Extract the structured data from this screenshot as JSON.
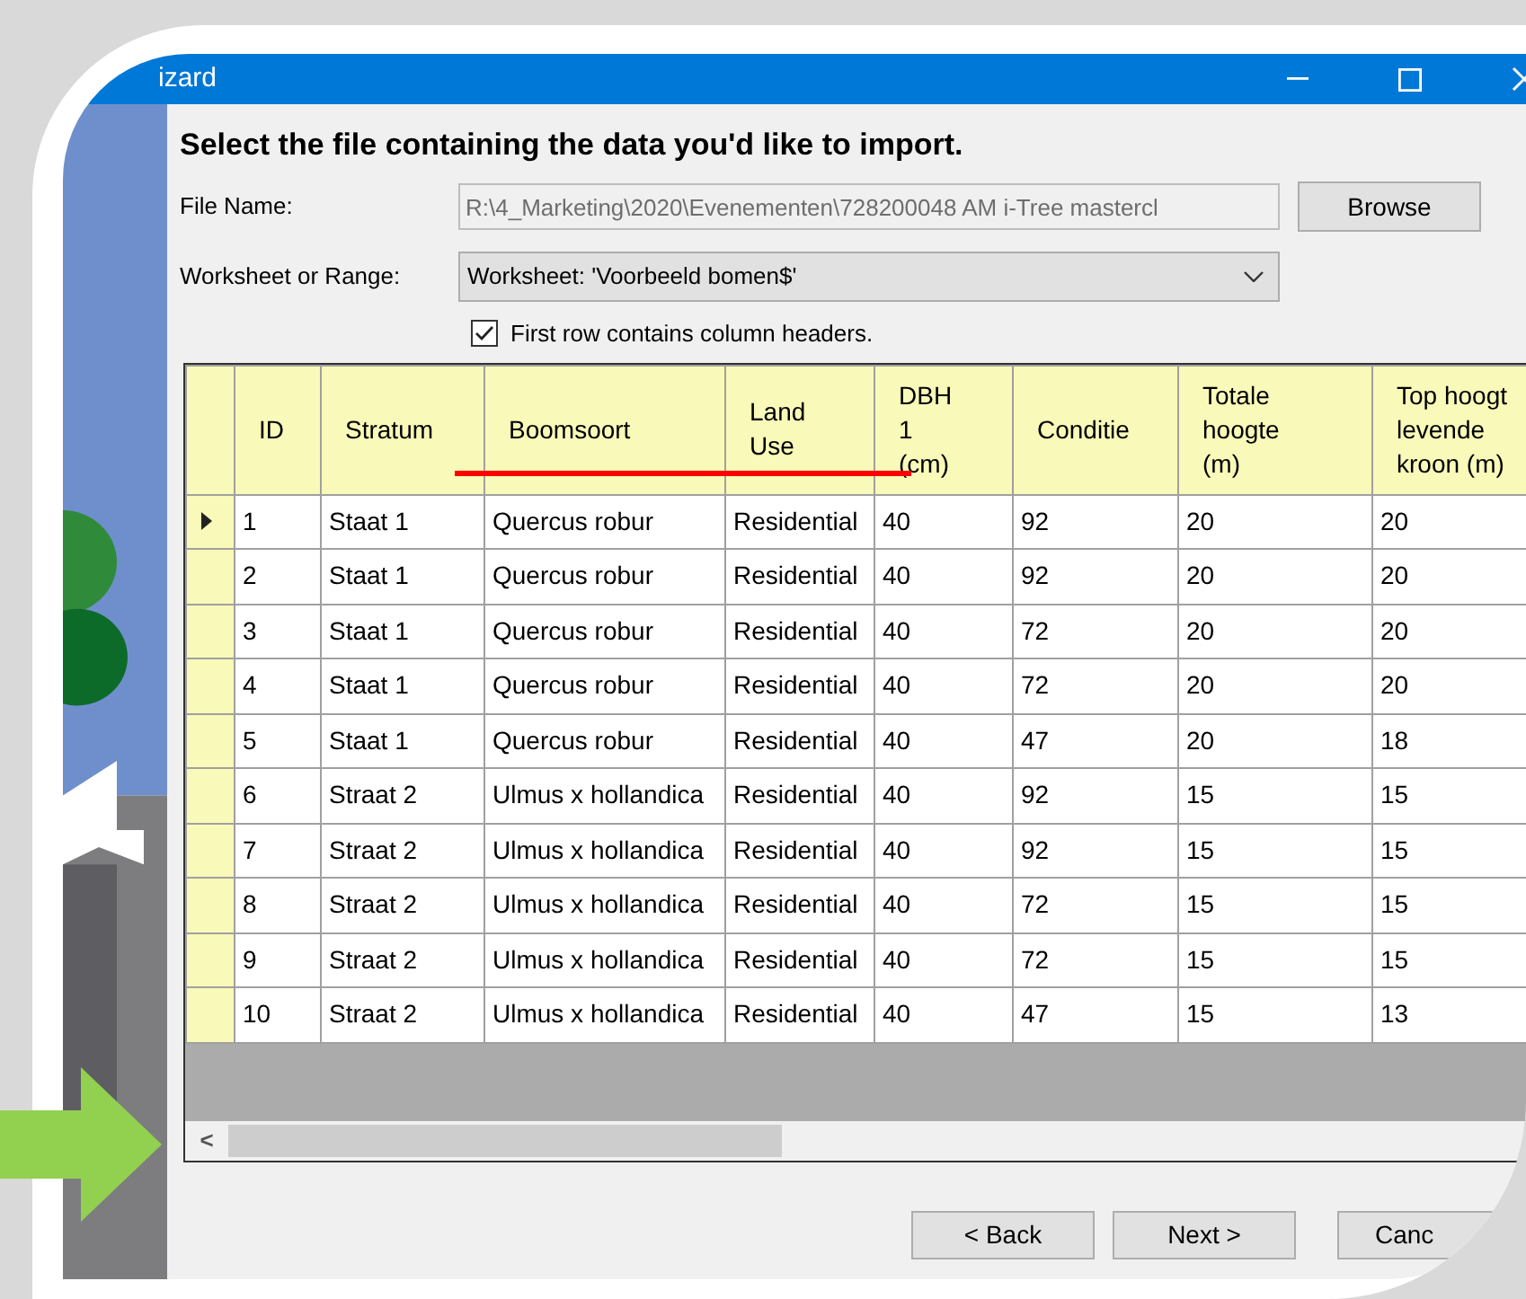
{
  "window": {
    "title": "izard"
  },
  "heading": "Select the file containing the data you'd like to import.",
  "file_name": {
    "label": "File Name:",
    "value": "R:\\4_Marketing\\2020\\Evenementen\\728200048 AM i-Tree mastercl",
    "disabled": true
  },
  "browse_button": "Browse",
  "worksheet": {
    "label": "Worksheet or Range:",
    "value": "Worksheet: 'Voorbeeld bomen$'"
  },
  "header_checkbox": {
    "label": "First row contains column headers.",
    "checked": true
  },
  "table": {
    "columns": [
      "ID",
      "Stratum",
      "Boomsoort",
      "Land\nUse",
      "DBH\n1\n(cm)",
      "Conditie",
      "Totale\nhoogte\n(m)",
      "Top hoogt\nlevende\nkroon (m)"
    ],
    "rows": [
      {
        "selected": true,
        "cells": [
          "1",
          "Staat 1",
          "Quercus robur",
          "Residential",
          "40",
          "92",
          "20",
          "20"
        ]
      },
      {
        "selected": false,
        "cells": [
          "2",
          "Staat 1",
          "Quercus robur",
          "Residential",
          "40",
          "92",
          "20",
          "20"
        ]
      },
      {
        "selected": false,
        "cells": [
          "3",
          "Staat 1",
          "Quercus robur",
          "Residential",
          "40",
          "72",
          "20",
          "20"
        ]
      },
      {
        "selected": false,
        "cells": [
          "4",
          "Staat 1",
          "Quercus robur",
          "Residential",
          "40",
          "72",
          "20",
          "20"
        ]
      },
      {
        "selected": false,
        "cells": [
          "5",
          "Staat 1",
          "Quercus robur",
          "Residential",
          "40",
          "47",
          "20",
          "18"
        ]
      },
      {
        "selected": false,
        "cells": [
          "6",
          "Straat 2",
          "Ulmus x hollandica",
          "Residential",
          "40",
          "92",
          "15",
          "15"
        ]
      },
      {
        "selected": false,
        "cells": [
          "7",
          "Straat 2",
          "Ulmus x hollandica",
          "Residential",
          "40",
          "92",
          "15",
          "15"
        ]
      },
      {
        "selected": false,
        "cells": [
          "8",
          "Straat 2",
          "Ulmus x hollandica",
          "Residential",
          "40",
          "72",
          "15",
          "15"
        ]
      },
      {
        "selected": false,
        "cells": [
          "9",
          "Straat 2",
          "Ulmus x hollandica",
          "Residential",
          "40",
          "72",
          "15",
          "15"
        ]
      },
      {
        "selected": false,
        "cells": [
          "10",
          "Straat 2",
          "Ulmus x hollandica",
          "Residential",
          "40",
          "47",
          "15",
          "13"
        ]
      }
    ]
  },
  "scroll_left": "<",
  "buttons": [
    "< Back",
    "Next >",
    "Canc"
  ]
}
